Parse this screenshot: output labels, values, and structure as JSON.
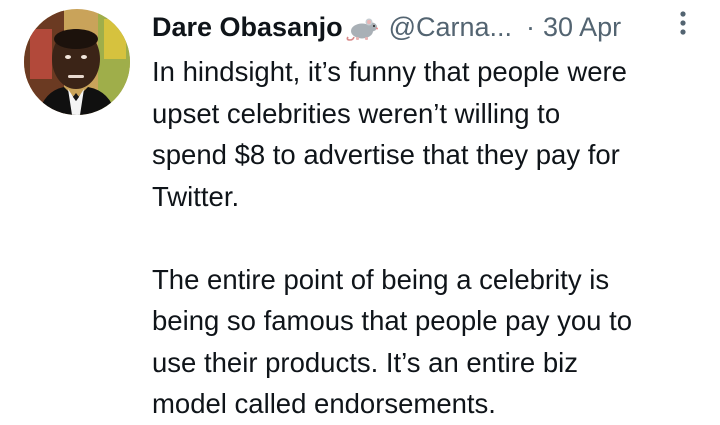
{
  "tweet": {
    "author": {
      "display_name": "Dare Obasanjo",
      "badge_icon": "rat-emoji-icon",
      "handle": "@Carna...",
      "avatar_icon": "avatar-icon"
    },
    "separator": "·",
    "date": "30 Apr",
    "more_icon": "more-options-icon",
    "paragraphs": [
      "In hindsight, it’s funny that people were\nupset celebrities weren’t willing to\nspend $8 to advertise that they pay for\nTwitter.",
      "The entire point of being a celebrity is\nbeing so famous that people pay you to\nuse their products. It’s an entire biz\nmodel called endorsements."
    ]
  },
  "colors": {
    "text_primary": "#0f1419",
    "text_secondary": "#536471",
    "background": "#ffffff"
  }
}
